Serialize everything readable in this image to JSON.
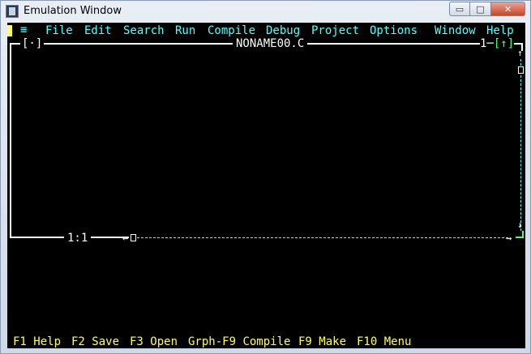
{
  "window": {
    "title": "Emulation Window",
    "controls": {
      "minimize": "▭",
      "maximize": "□",
      "close": "✕"
    }
  },
  "menubar": {
    "system_menu": "≡",
    "items": [
      "File",
      "Edit",
      "Search",
      "Run",
      "Compile",
      "Debug",
      "Project",
      "Options",
      "Window",
      "Help"
    ]
  },
  "editor": {
    "close_box": "[·]",
    "filename": "NONAME00.C",
    "window_number": "1",
    "zoom_box": "[↑]",
    "cursor_position": "1:1"
  },
  "statusbar": {
    "hotkeys": [
      {
        "key": "F1",
        "label": "Help"
      },
      {
        "key": "F2",
        "label": "Save"
      },
      {
        "key": "F3",
        "label": "Open"
      },
      {
        "key": "Grph-F9",
        "label": "Compile"
      },
      {
        "key": "F9",
        "label": "Make"
      },
      {
        "key": "F10",
        "label": "Menu"
      }
    ]
  },
  "colors": {
    "background": "#000000",
    "menu_text": "#55ffff",
    "frame": "#ffffff",
    "hotkey_text": "#ffff55",
    "active_marker": "#55ff55"
  }
}
